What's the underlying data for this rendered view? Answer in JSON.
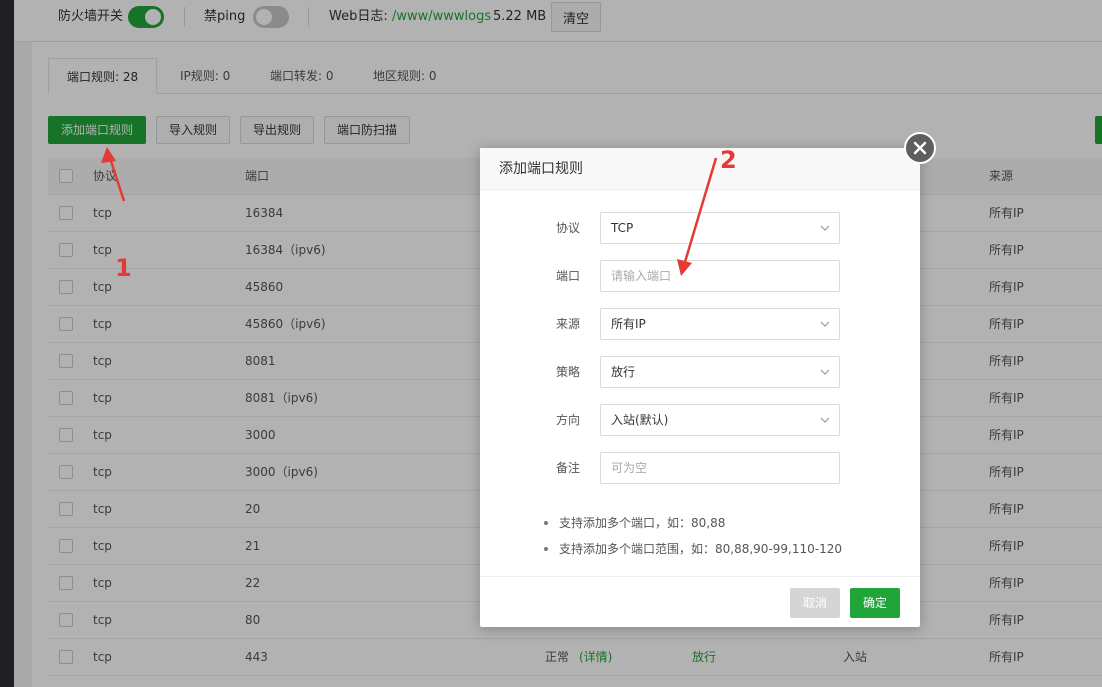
{
  "topbar": {
    "firewall_label": "防火墙开关",
    "firewall_on": true,
    "ping_label": "禁ping",
    "ping_on": false,
    "weblog_label": "Web日志:",
    "weblog_path": "/www/wwwlogs",
    "weblog_size": "5.22 MB",
    "clear_label": "清空"
  },
  "tabs": [
    {
      "label": "端口规则: 28",
      "active": true
    },
    {
      "label": "IP规则: 0",
      "active": false
    },
    {
      "label": "端口转发: 0",
      "active": false
    },
    {
      "label": "地区规则: 0",
      "active": false
    }
  ],
  "toolbar": {
    "add_port_rule": "添加端口规则",
    "import_rules": "导入规则",
    "export_rules": "导出规则",
    "port_scan_protection": "端口防扫描"
  },
  "table": {
    "headers": {
      "protocol": "协议",
      "port": "端口",
      "source": "来源"
    },
    "rows": [
      {
        "protocol": "tcp",
        "port": "16384",
        "source": "所有IP"
      },
      {
        "protocol": "tcp",
        "port": "16384（ipv6)",
        "source": "所有IP"
      },
      {
        "protocol": "tcp",
        "port": "45860",
        "source": "所有IP"
      },
      {
        "protocol": "tcp",
        "port": "45860（ipv6)",
        "source": "所有IP"
      },
      {
        "protocol": "tcp",
        "port": "8081",
        "source": "所有IP"
      },
      {
        "protocol": "tcp",
        "port": "8081（ipv6)",
        "source": "所有IP"
      },
      {
        "protocol": "tcp",
        "port": "3000",
        "source": "所有IP"
      },
      {
        "protocol": "tcp",
        "port": "3000（ipv6)",
        "source": "所有IP"
      },
      {
        "protocol": "tcp",
        "port": "20",
        "source": "所有IP"
      },
      {
        "protocol": "tcp",
        "port": "21",
        "source": "所有IP"
      },
      {
        "protocol": "tcp",
        "port": "22",
        "source": "所有IP"
      },
      {
        "protocol": "tcp",
        "port": "80",
        "source": "所有IP"
      },
      {
        "protocol": "tcp",
        "port": "443",
        "status": "正常",
        "details": "(详情)",
        "policy": "放行",
        "direction": "入站",
        "source": "所有IP"
      }
    ]
  },
  "dialog": {
    "title": "添加端口规则",
    "fields": {
      "protocol": {
        "label": "协议",
        "value": "TCP"
      },
      "port": {
        "label": "端口",
        "placeholder": "请输入端口"
      },
      "source": {
        "label": "来源",
        "value": "所有IP"
      },
      "policy": {
        "label": "策略",
        "value": "放行"
      },
      "direction": {
        "label": "方向",
        "value": "入站(默认)"
      },
      "remark": {
        "label": "备注",
        "placeholder": "可为空"
      }
    },
    "notes": [
      "支持添加多个端口，如：80,88",
      "支持添加多个端口范围，如：80,88,90-99,110-120"
    ],
    "cancel_label": "取消",
    "confirm_label": "确定"
  },
  "annotations": {
    "label1": "1",
    "label2": "2"
  },
  "colors": {
    "accent": "#20a53a",
    "annotation": "#e53935",
    "overlay": "rgba(0,0,0,0.30)"
  }
}
